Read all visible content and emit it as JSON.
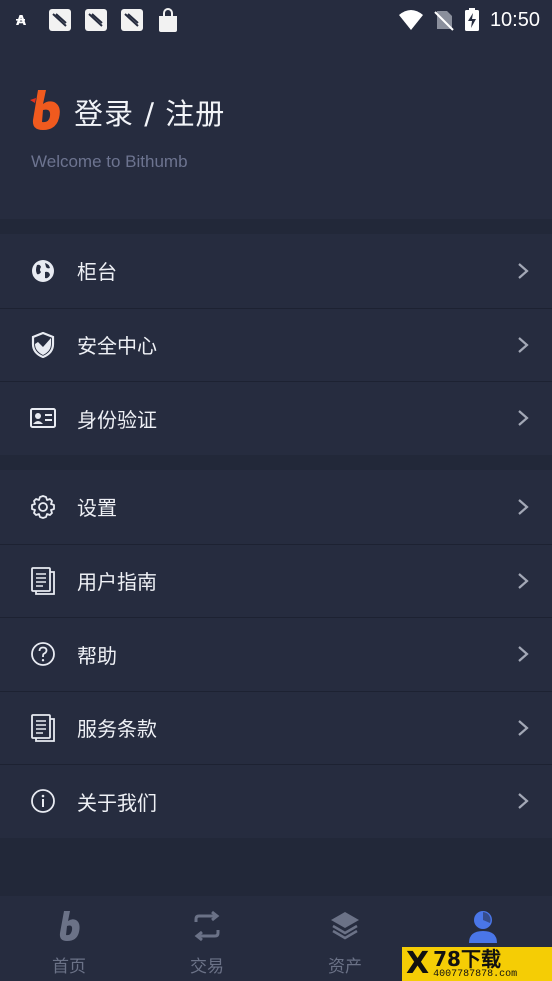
{
  "status_bar": {
    "time": "10:50",
    "left_icons": [
      "font-icon",
      "app-notification-icon",
      "app-notification-icon",
      "app-notification-icon",
      "shopping-bag-icon"
    ],
    "right_icons": [
      "wifi-icon",
      "no-sim-icon",
      "battery-charging-icon"
    ]
  },
  "header": {
    "logo": "bithumb-logo",
    "title": "登录 / 注册",
    "subtitle": "Welcome to Bithumb"
  },
  "menu_group_1": [
    {
      "label": "柜台",
      "icon": "globe-icon"
    },
    {
      "label": "安全中心",
      "icon": "shield-icon"
    },
    {
      "label": "身份验证",
      "icon": "id-card-icon"
    }
  ],
  "menu_group_2": [
    {
      "label": "设置",
      "icon": "gear-icon"
    },
    {
      "label": "用户指南",
      "icon": "document-icon"
    },
    {
      "label": "帮助",
      "icon": "question-icon"
    },
    {
      "label": "服务条款",
      "icon": "document-icon"
    },
    {
      "label": "关于我们",
      "icon": "info-icon"
    }
  ],
  "tab_bar": {
    "tabs": [
      {
        "label": "首页",
        "icon": "bithumb-home-icon"
      },
      {
        "label": "交易",
        "icon": "exchange-arrows-icon"
      },
      {
        "label": "资产",
        "icon": "layers-icon"
      },
      {
        "label": "",
        "icon": "user-icon",
        "active": true
      }
    ]
  },
  "watermark": {
    "x": "X",
    "text": "78下载",
    "phone": "4007787878.com"
  },
  "colors": {
    "background": "#222839",
    "panel": "#262c3f",
    "accent_orange": "#f05a1e",
    "active_blue": "#4a76e8",
    "muted": "#6b7287"
  }
}
